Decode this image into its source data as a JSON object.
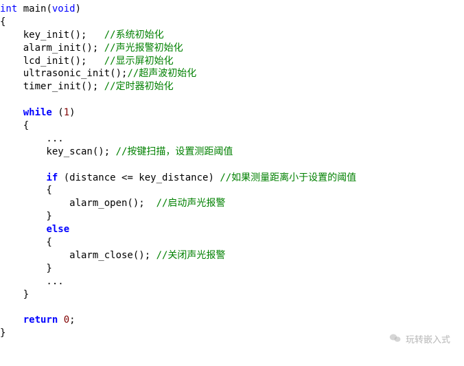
{
  "code": {
    "l1_int": "int",
    "l1_rest": " main(",
    "l1_void": "void",
    "l1_rest2": ")",
    "l2": "{",
    "l3_code": "    key_init();   ",
    "l3_cmt": "//系统初始化",
    "l4_code": "    alarm_init(); ",
    "l4_cmt": "//声光报警初始化",
    "l5_code": "    lcd_init();   ",
    "l5_cmt": "//显示屏初始化",
    "l6_code": "    ultrasonic_init();",
    "l6_cmt": "//超声波初始化",
    "l7_code": "    timer_init(); ",
    "l7_cmt": "//定时器初始化",
    "l8": "",
    "l9_pre": "    ",
    "l9_while": "while",
    "l9_sp": " (",
    "l9_one": "1",
    "l9_post": ")",
    "l10": "    {",
    "l11": "        ...",
    "l12_code": "        key_scan(); ",
    "l12_cmt": "//按键扫描，设置测距阈值",
    "l13": "",
    "l14_pre": "        ",
    "l14_if": "if",
    "l14_mid": " (distance <= key_distance) ",
    "l14_cmt": "//如果测量距离小于设置的阈值",
    "l15": "        {",
    "l16_code": "            alarm_open();  ",
    "l16_cmt": "//启动声光报警",
    "l17": "        }",
    "l18_pre": "        ",
    "l18_else": "else",
    "l19": "        {",
    "l20_code": "            alarm_close(); ",
    "l20_cmt": "//关闭声光报警",
    "l21": "        }",
    "l22": "        ...",
    "l23": "    }",
    "l24": "",
    "l25_pre": "    ",
    "l25_return": "return",
    "l25_sp": " ",
    "l25_zero": "0",
    "l25_post": ";",
    "l26": "}"
  },
  "watermark": "玩转嵌入式"
}
